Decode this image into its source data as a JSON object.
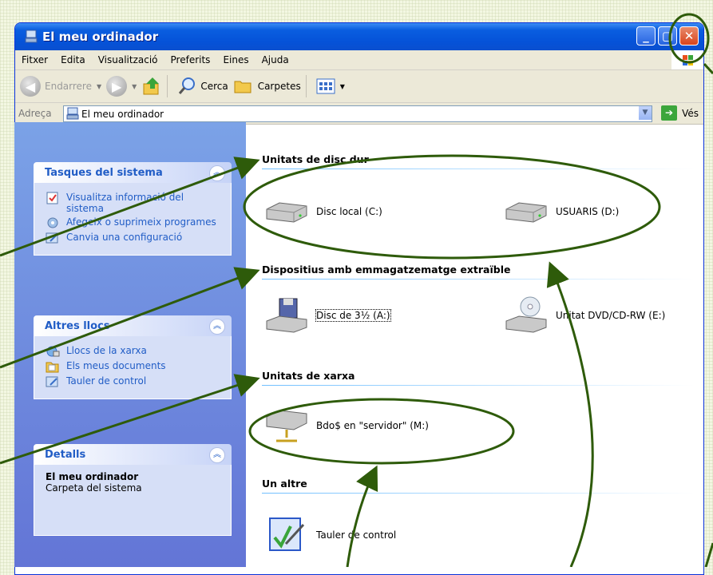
{
  "window": {
    "title": "El meu ordinador"
  },
  "menu": [
    "Fitxer",
    "Edita",
    "Visualització",
    "Preferits",
    "Eines",
    "Ajuda"
  ],
  "toolbar": {
    "back": "Endarrere",
    "search": "Cerca",
    "folders": "Carpetes"
  },
  "address": {
    "label": "Adreça",
    "value": "El meu ordinador",
    "go": "Vés"
  },
  "left_panels": {
    "system_tasks": {
      "title": "Tasques del sistema",
      "items": [
        "Visualitza informació del sistema",
        "Afegeix o suprimeix programes",
        "Canvia una configuració"
      ]
    },
    "other_places": {
      "title": "Altres llocs",
      "items": [
        "Llocs de la xarxa",
        "Els meus documents",
        "Tauler de control"
      ]
    },
    "details": {
      "title": "Detalls",
      "name": "El meu ordinador",
      "sub": "Carpeta del sistema"
    }
  },
  "groups": {
    "hard_disks": {
      "header": "Unitats de disc dur",
      "items": [
        "Disc local (C:)",
        "USUARIS (D:)"
      ]
    },
    "removable": {
      "header": "Dispositius amb emmagatzematge extraïble",
      "items": [
        "Disc de 3½ (A:)",
        "Unitat DVD/CD-RW (E:)"
      ]
    },
    "network": {
      "header": "Unitats de xarxa",
      "items": [
        "Bdo$ en \"servidor\" (M:)"
      ]
    },
    "other": {
      "header": "Un altre",
      "items": [
        "Tauler de control"
      ]
    }
  },
  "colors": {
    "annotation": "#2e5b0a",
    "title_blue": "#0552d8",
    "link_blue": "#215dc6"
  }
}
